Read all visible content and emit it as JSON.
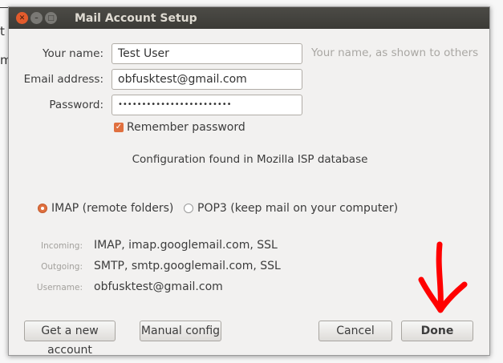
{
  "background": {
    "fragments": [
      "t",
      "m"
    ]
  },
  "window": {
    "title": "Mail Account Setup"
  },
  "form": {
    "name_label": "Your name:",
    "name_value": "Test User",
    "name_hint": "Your name, as shown to others",
    "email_label": "Email address:",
    "email_value": "obfusktest@gmail.com",
    "password_label": "Password:",
    "password_value": "••••••••••••••••••••••••",
    "remember_label": "Remember password",
    "remember_checked": true
  },
  "status": "Configuration found in Mozilla ISP database",
  "protocol": {
    "options": [
      "IMAP (remote folders)",
      "POP3 (keep mail on your computer)"
    ],
    "selected": "IMAP (remote folders)"
  },
  "summary": {
    "incoming_label": "Incoming:",
    "incoming_value": "IMAP, imap.googlemail.com, SSL",
    "outgoing_label": "Outgoing:",
    "outgoing_value": "SMTP, smtp.googlemail.com, SSL",
    "username_label": "Username:",
    "username_value": "obfusktest@gmail.com"
  },
  "buttons": {
    "new_account": "Get a new account",
    "manual": "Manual config",
    "cancel": "Cancel",
    "done": "Done"
  },
  "colors": {
    "accent": "#e0703f",
    "annotation": "#ff0000"
  }
}
